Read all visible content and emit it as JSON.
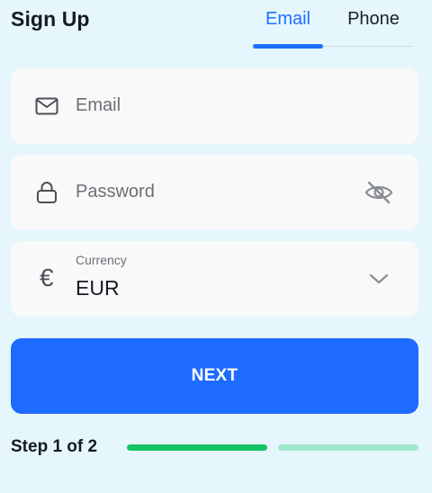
{
  "header": {
    "title": "Sign Up",
    "tabs": [
      {
        "label": "Email",
        "active": true
      },
      {
        "label": "Phone",
        "active": false
      }
    ]
  },
  "form": {
    "email": {
      "placeholder": "Email",
      "icon": "mail-icon"
    },
    "password": {
      "placeholder": "Password",
      "icon": "lock-icon",
      "toggle_icon": "eye-off-icon"
    },
    "currency": {
      "label": "Currency",
      "value": "EUR",
      "symbol": "€",
      "icon": "chevron-down-icon"
    }
  },
  "actions": {
    "next_label": "NEXT"
  },
  "progress": {
    "label": "Step 1 of 2",
    "current_step": 1,
    "total_steps": 2
  },
  "colors": {
    "accent": "#1e6bff",
    "progress_done": "#14c466",
    "progress_pending": "#9ee9cc",
    "background": "#e6f6fd"
  }
}
